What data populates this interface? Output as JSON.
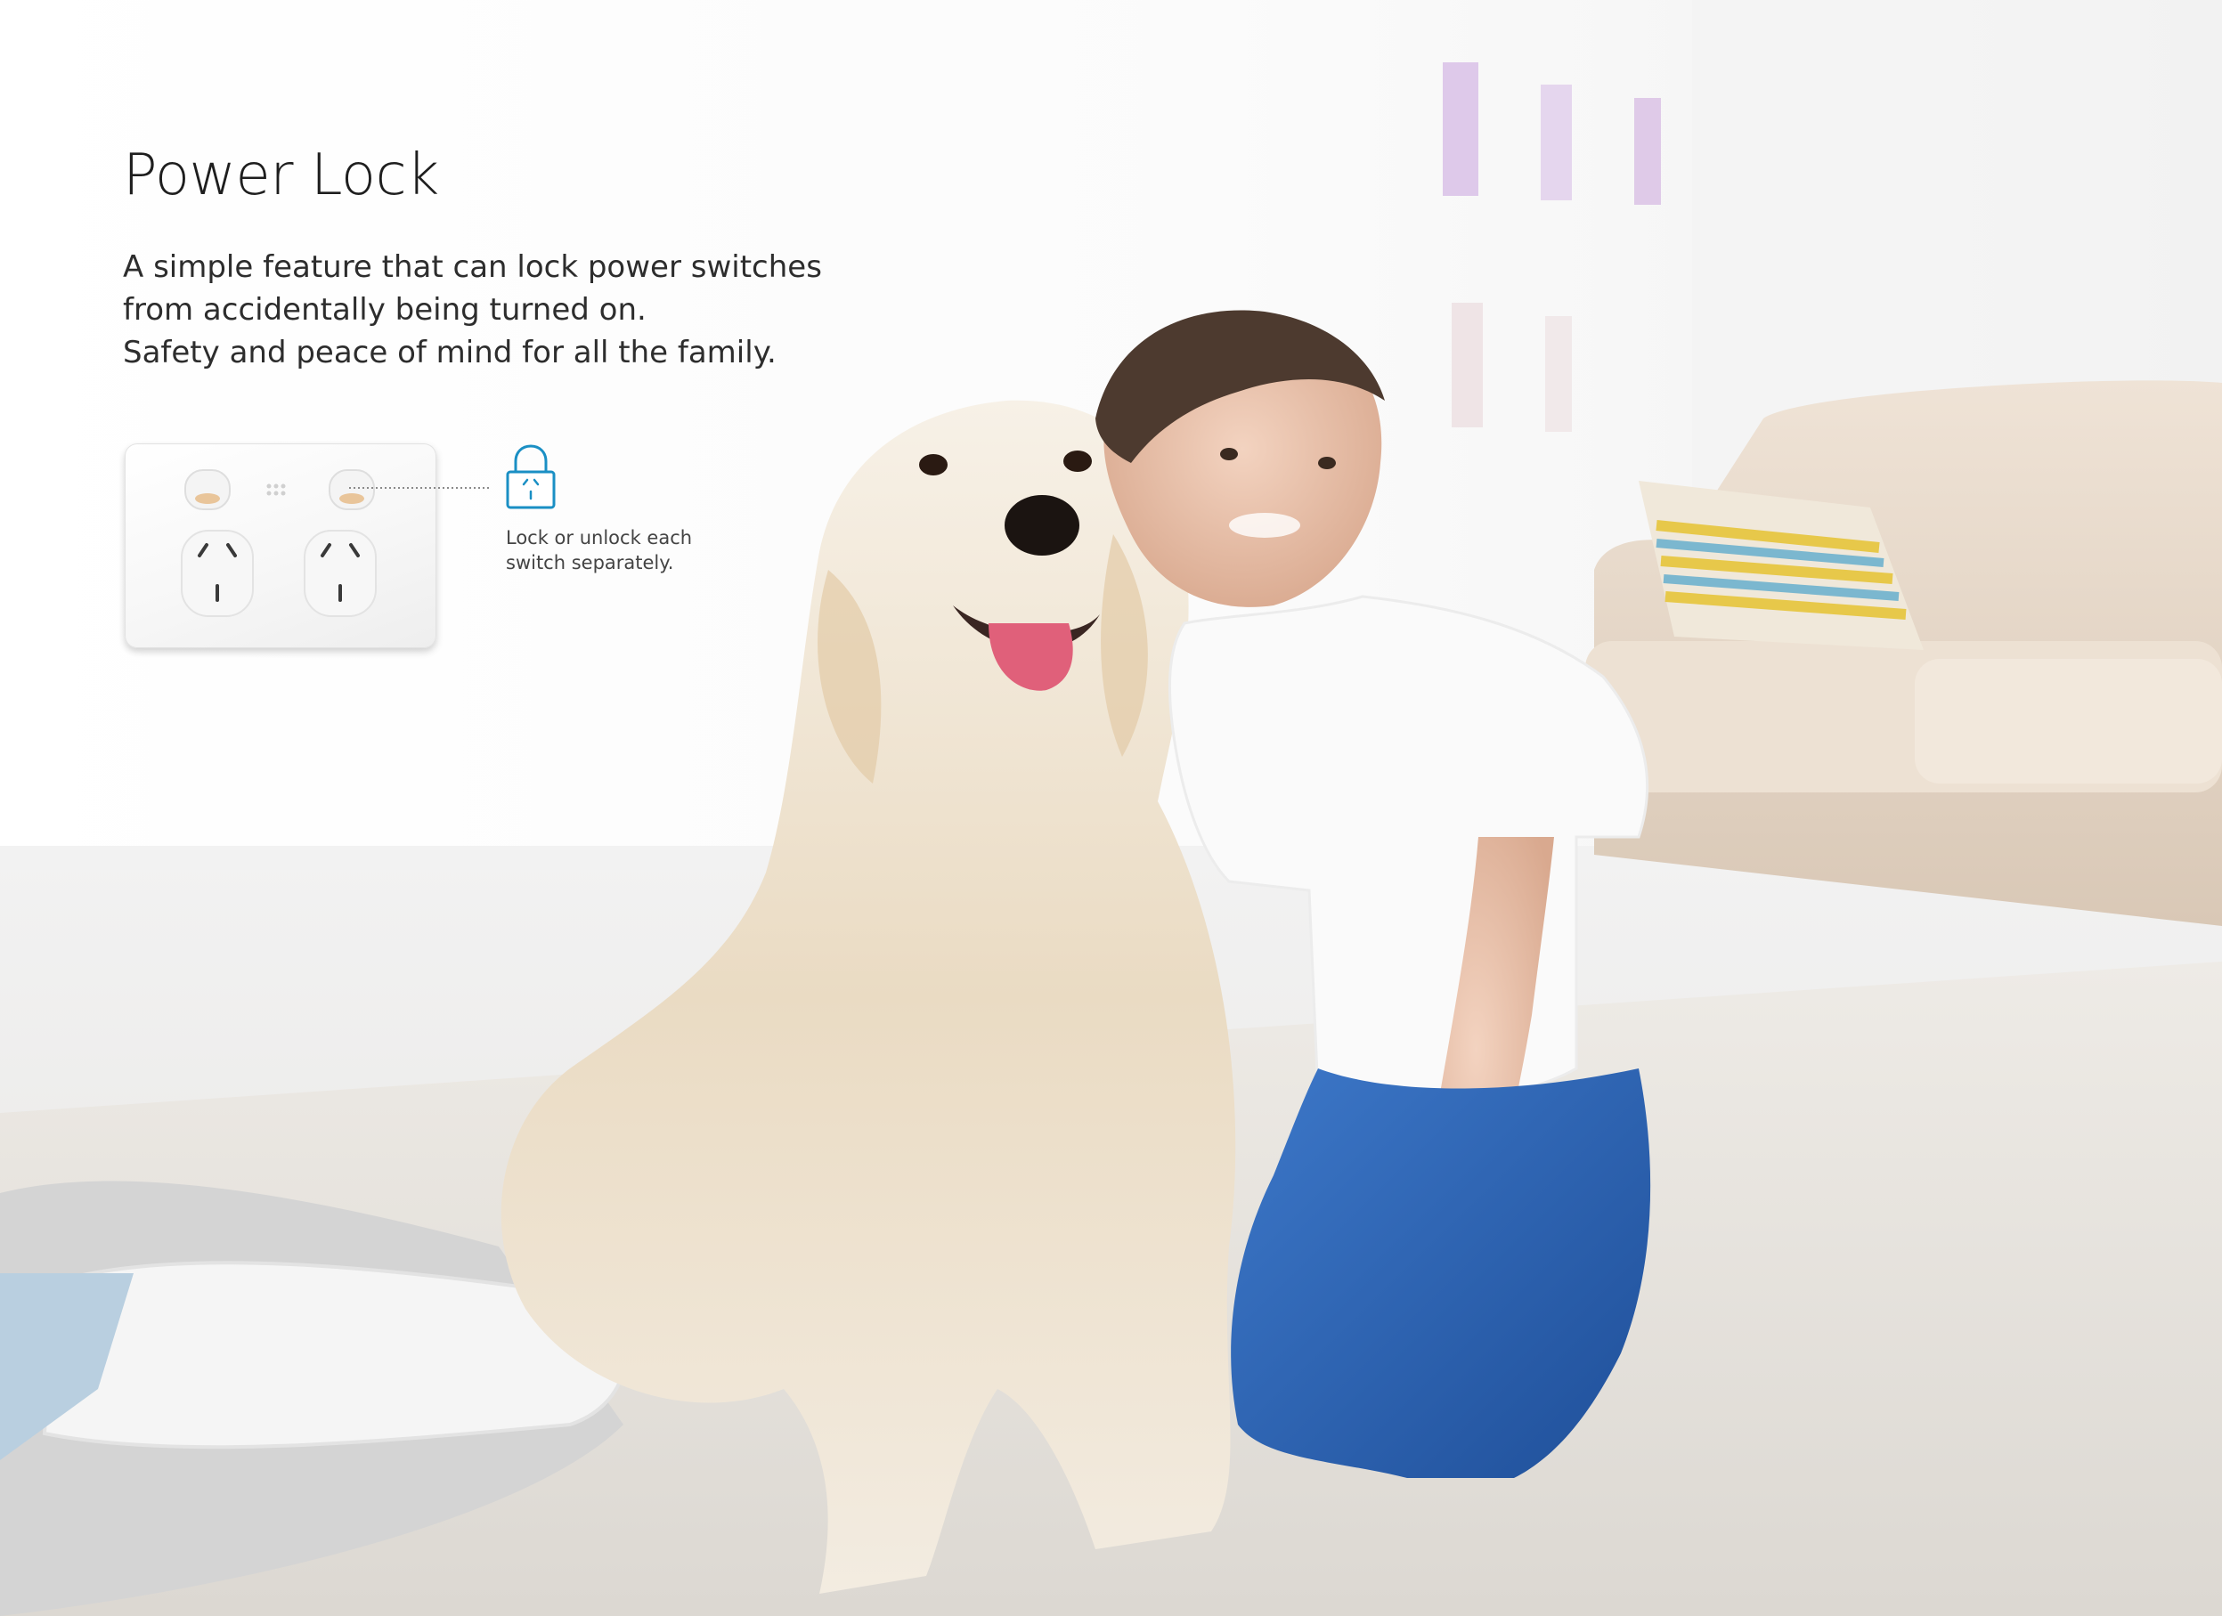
{
  "heading": {
    "title": "Power Lock"
  },
  "description": {
    "lines": [
      "A simple feature that can lock power switches",
      "from accidentally being turned on.",
      "Safety and peace of mind for all the family."
    ]
  },
  "callout": {
    "lines": [
      "Lock or unlock each",
      "switch separately."
    ],
    "icon": "padlock-icon",
    "accent_color": "#1a8fc4"
  },
  "photo": {
    "subject": "boy-and-dog-photo"
  }
}
